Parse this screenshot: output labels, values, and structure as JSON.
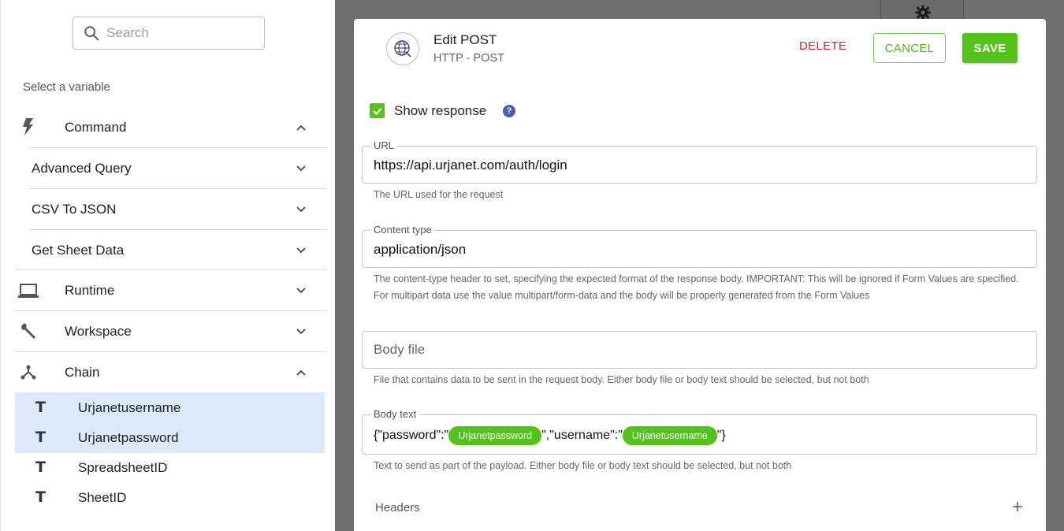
{
  "sidebar": {
    "search_placeholder": "Search",
    "select_label": "Select a variable",
    "categories": {
      "command": "Command",
      "advanced_query": "Advanced Query",
      "csv_to_json": "CSV To JSON",
      "get_sheet_data": "Get Sheet Data",
      "runtime": "Runtime",
      "workspace": "Workspace",
      "chain": "Chain"
    },
    "variables": [
      "Urjanetusername",
      "Urjanetpassword",
      "SpreadsheetID",
      "SheetID"
    ]
  },
  "dialog": {
    "title": "Edit POST",
    "subtitle": "HTTP - POST",
    "delete_label": "DELETE",
    "cancel_label": "CANCEL",
    "save_label": "SAVE",
    "show_response_label": "Show response",
    "help_label": "?",
    "url": {
      "legend": "URL",
      "value": "https://api.urjanet.com/auth/login",
      "hint": "The URL used for the request"
    },
    "content_type": {
      "legend": "Content type",
      "value": "application/json",
      "hint": "The content-type header to set, specifying the expected format of the response body. IMPORTANT: This will be ignored if Form Values are specified. For multipart data use the value multipart/form-data and the body will be properly generated from the Form Values"
    },
    "body_file": {
      "placeholder": "Body file",
      "hint": "File that contains data to be sent in the request body. Either body file or body text should be selected, but not both"
    },
    "body_text": {
      "legend": "Body text",
      "part1": "{\"password\":\"",
      "chip1": "Urjanetpassword",
      "part2": "\",\"username\":\"",
      "chip2": "Urjanetusername",
      "part3": "\"}",
      "hint": "Text to send as part of the payload. Either body file or body text should be selected, but not both"
    },
    "headers_label": "Headers",
    "add_label": "+"
  },
  "colors": {
    "accent_green": "#53c21a",
    "delete_red": "#e02020",
    "help_blue": "#4a5db3",
    "selected_bg": "#dce9fb"
  }
}
